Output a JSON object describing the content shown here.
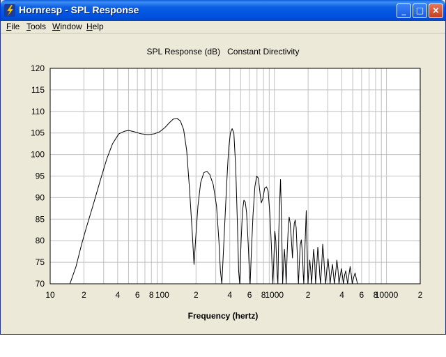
{
  "window": {
    "title": "Hornresp - SPL Response",
    "minimize_glyph": "_",
    "maximize_glyph": "□",
    "close_glyph": "×",
    "app_icon": "lightning-bolt-icon"
  },
  "menu": {
    "file": "File",
    "tools": "Tools",
    "window": "Window",
    "help": "Help"
  },
  "colors": {
    "title_bar": "#0054e3",
    "close_button": "#c23f1f",
    "window_face": "#ece9d8",
    "plot_background": "#ffffff",
    "grid": "#c0c0c0",
    "trace": "#000000"
  },
  "chart_data": {
    "type": "line",
    "title": "SPL Response (dB)   Constant Directivity",
    "xlabel": "Frequency (hertz)",
    "ylabel": "",
    "xscale": "log",
    "xlim": [
      10,
      20000
    ],
    "ylim": [
      70,
      120
    ],
    "grid": true,
    "legend": "none",
    "y_ticks": [
      70,
      75,
      80,
      85,
      90,
      95,
      100,
      105,
      110,
      115,
      120
    ],
    "x_ticks": [
      {
        "value": 10,
        "label": "10"
      },
      {
        "value": 20,
        "label": "2"
      },
      {
        "value": 40,
        "label": "4"
      },
      {
        "value": 60,
        "label": "6"
      },
      {
        "value": 80,
        "label": "8"
      },
      {
        "value": 100,
        "label": "100"
      },
      {
        "value": 200,
        "label": "2"
      },
      {
        "value": 400,
        "label": "4"
      },
      {
        "value": 600,
        "label": "6"
      },
      {
        "value": 800,
        "label": "8"
      },
      {
        "value": 1000,
        "label": "1000"
      },
      {
        "value": 2000,
        "label": "2"
      },
      {
        "value": 4000,
        "label": "4"
      },
      {
        "value": 6000,
        "label": "6"
      },
      {
        "value": 8000,
        "label": "8"
      },
      {
        "value": 10000,
        "label": "10000"
      },
      {
        "value": 20000,
        "label": "2"
      }
    ],
    "series": [
      {
        "points": [
          [
            15,
            70
          ],
          [
            17,
            74
          ],
          [
            19,
            79
          ],
          [
            21,
            83
          ],
          [
            24,
            88
          ],
          [
            28,
            94
          ],
          [
            32,
            99
          ],
          [
            36,
            102.5
          ],
          [
            41,
            104.8
          ],
          [
            46,
            105.4
          ],
          [
            50,
            105.6
          ],
          [
            56,
            105.3
          ],
          [
            65,
            104.8
          ],
          [
            75,
            104.6
          ],
          [
            85,
            104.8
          ],
          [
            95,
            105.3
          ],
          [
            105,
            106.2
          ],
          [
            115,
            107.3
          ],
          [
            125,
            108.2
          ],
          [
            135,
            108.4
          ],
          [
            145,
            107.8
          ],
          [
            155,
            105.8
          ],
          [
            165,
            101
          ],
          [
            175,
            92
          ],
          [
            185,
            82
          ],
          [
            192,
            74.5
          ],
          [
            198,
            80
          ],
          [
            208,
            88
          ],
          [
            220,
            93.5
          ],
          [
            235,
            95.8
          ],
          [
            250,
            96.1
          ],
          [
            265,
            95.4
          ],
          [
            285,
            93
          ],
          [
            305,
            88
          ],
          [
            320,
            80
          ],
          [
            330,
            73
          ],
          [
            340,
            70
          ],
          [
            355,
            80
          ],
          [
            375,
            93
          ],
          [
            390,
            101
          ],
          [
            405,
            105
          ],
          [
            420,
            106
          ],
          [
            435,
            105
          ],
          [
            452,
            97
          ],
          [
            468,
            84
          ],
          [
            480,
            73
          ],
          [
            490,
            70
          ],
          [
            505,
            80
          ],
          [
            520,
            87
          ],
          [
            535,
            89.4
          ],
          [
            550,
            89
          ],
          [
            565,
            86.5
          ],
          [
            585,
            79
          ],
          [
            600,
            72
          ],
          [
            608,
            70
          ],
          [
            625,
            78
          ],
          [
            645,
            86
          ],
          [
            670,
            92.5
          ],
          [
            695,
            95
          ],
          [
            720,
            94.5
          ],
          [
            745,
            91
          ],
          [
            765,
            88.8
          ],
          [
            790,
            89.8
          ],
          [
            820,
            92.2
          ],
          [
            850,
            92.5
          ],
          [
            880,
            91.5
          ],
          [
            910,
            86.5
          ],
          [
            940,
            79
          ],
          [
            960,
            72
          ],
          [
            970,
            70
          ],
          [
            990,
            76
          ],
          [
            1010,
            82.2
          ],
          [
            1030,
            80
          ],
          [
            1060,
            72
          ],
          [
            1075,
            70
          ],
          [
            1095,
            82
          ],
          [
            1115,
            89
          ],
          [
            1135,
            94.2
          ],
          [
            1155,
            86
          ],
          [
            1175,
            76
          ],
          [
            1185,
            70
          ],
          [
            1205,
            74
          ],
          [
            1230,
            78
          ],
          [
            1255,
            74
          ],
          [
            1275,
            70
          ],
          [
            1300,
            77
          ],
          [
            1330,
            83
          ],
          [
            1355,
            85.5
          ],
          [
            1385,
            84
          ],
          [
            1420,
            80
          ],
          [
            1450,
            76
          ],
          [
            1475,
            81
          ],
          [
            1505,
            84
          ],
          [
            1535,
            84.8
          ],
          [
            1565,
            83
          ],
          [
            1600,
            77
          ],
          [
            1625,
            72
          ],
          [
            1640,
            70
          ],
          [
            1665,
            74
          ],
          [
            1700,
            79
          ],
          [
            1740,
            80.2
          ],
          [
            1780,
            77
          ],
          [
            1810,
            72
          ],
          [
            1830,
            70
          ],
          [
            1860,
            76
          ],
          [
            1895,
            82
          ],
          [
            1925,
            87
          ],
          [
            1950,
            80
          ],
          [
            1975,
            74
          ],
          [
            1995,
            70
          ],
          [
            2030,
            73
          ],
          [
            2070,
            75.5
          ],
          [
            2110,
            73
          ],
          [
            2150,
            70
          ],
          [
            2190,
            74
          ],
          [
            2240,
            78
          ],
          [
            2290,
            75
          ],
          [
            2330,
            70
          ],
          [
            2380,
            73.5
          ],
          [
            2440,
            78.5
          ],
          [
            2490,
            76
          ],
          [
            2540,
            72
          ],
          [
            2580,
            70
          ],
          [
            2640,
            74
          ],
          [
            2700,
            79.2
          ],
          [
            2760,
            76
          ],
          [
            2820,
            72
          ],
          [
            2870,
            70
          ],
          [
            2940,
            73.5
          ],
          [
            3010,
            75.8
          ],
          [
            3080,
            73
          ],
          [
            3140,
            70
          ],
          [
            3220,
            72.5
          ],
          [
            3300,
            74.5
          ],
          [
            3370,
            72
          ],
          [
            3430,
            70
          ],
          [
            3520,
            72.5
          ],
          [
            3610,
            75.5
          ],
          [
            3700,
            73
          ],
          [
            3770,
            70
          ],
          [
            3870,
            72
          ],
          [
            3970,
            73.5
          ],
          [
            4060,
            71.5
          ],
          [
            4130,
            70
          ],
          [
            4230,
            72
          ],
          [
            4330,
            73
          ],
          [
            4420,
            71.5
          ],
          [
            4500,
            70
          ],
          [
            4620,
            72
          ],
          [
            4740,
            74
          ],
          [
            4850,
            72.2
          ],
          [
            4950,
            70
          ],
          [
            5100,
            71.5
          ],
          [
            5250,
            72.5
          ],
          [
            5400,
            71
          ],
          [
            5520,
            70
          ]
        ]
      }
    ]
  }
}
